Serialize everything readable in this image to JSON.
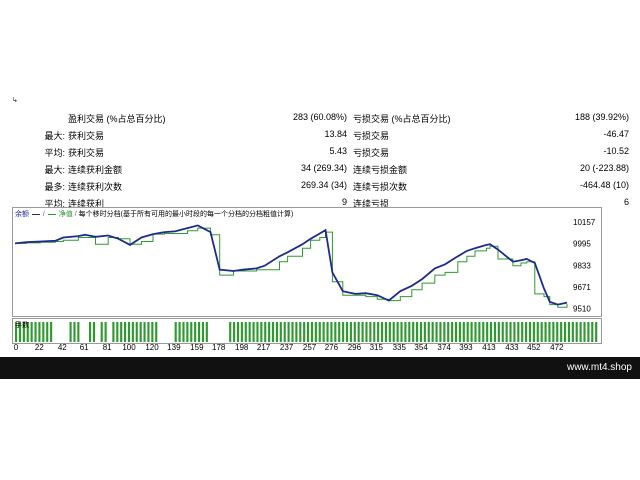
{
  "marker": "↳",
  "stats": [
    {
      "prefix": "",
      "label": "盈利交易 (%占总百分比)",
      "value1": "283 (60.08%)",
      "label2": "亏损交易 (%占总百分比)",
      "value2": "188 (39.92%)"
    },
    {
      "prefix": "最大:",
      "label": "获利交易",
      "value1": "13.84",
      "label2": "亏损交易",
      "value2": "-46.47"
    },
    {
      "prefix": "平均:",
      "label": "获利交易",
      "value1": "5.43",
      "label2": "亏损交易",
      "value2": "-10.52"
    },
    {
      "prefix": "最大:",
      "label": "连续获利金额",
      "value1": "34 (269.34)",
      "label2": "连续亏损金额",
      "value2": "20 (-223.88)"
    },
    {
      "prefix": "最多:",
      "label": "连续获利次数",
      "value1": "269.34 (34)",
      "label2": "连续亏损次数",
      "value2": "-464.48 (10)"
    },
    {
      "prefix": "平均:",
      "label": "连续获利",
      "value1": "9",
      "label2": "连续亏损",
      "value2": "6"
    }
  ],
  "chart": {
    "legend_balance": "余额",
    "legend_equity": "净值",
    "title_text": "每个移时分档(基于所有可用的最小时段的每一个分档的分档粗值计算)",
    "volume_label": "手数"
  },
  "chart_data": {
    "type": "line",
    "x_ticks": [
      "0",
      "22",
      "42",
      "61",
      "81",
      "100",
      "120",
      "139",
      "159",
      "178",
      "198",
      "217",
      "237",
      "257",
      "276",
      "296",
      "315",
      "335",
      "354",
      "374",
      "393",
      "413",
      "433",
      "452",
      "472"
    ],
    "y_ticks": [
      "10157",
      "9995",
      "9833",
      "9671",
      "9510"
    ],
    "ylim": [
      9485,
      10200
    ],
    "xlim": [
      0,
      480
    ],
    "series": [
      {
        "name": "余额",
        "color": "#1f2a8c",
        "x": [
          0,
          10,
          22,
          35,
          42,
          55,
          61,
          70,
          81,
          90,
          100,
          110,
          120,
          130,
          139,
          150,
          159,
          170,
          178,
          190,
          198,
          210,
          217,
          230,
          237,
          250,
          257,
          265,
          270,
          276,
          285,
          296,
          305,
          315,
          325,
          335,
          345,
          354,
          365,
          374,
          385,
          393,
          400,
          410,
          413,
          420,
          433,
          440,
          445,
          452,
          460,
          465,
          472,
          480
        ],
        "y": [
          9996,
          10005,
          10010,
          10015,
          10040,
          10050,
          10060,
          10045,
          10055,
          10030,
          9985,
          10040,
          10065,
          10080,
          10085,
          10110,
          10130,
          10080,
          9800,
          9790,
          9800,
          9810,
          9830,
          9900,
          9930,
          9990,
          10030,
          10070,
          10095,
          9780,
          9640,
          9620,
          9625,
          9610,
          9570,
          9640,
          9680,
          9730,
          9810,
          9840,
          9900,
          9940,
          9960,
          9985,
          9990,
          9950,
          9860,
          9870,
          9880,
          9850,
          9660,
          9560,
          9540,
          9555
        ]
      },
      {
        "name": "净值",
        "color": "#2e9a2e",
        "x": [
          0,
          10,
          22,
          35,
          42,
          55,
          61,
          70,
          81,
          90,
          100,
          110,
          120,
          130,
          139,
          150,
          159,
          170,
          178,
          190,
          198,
          210,
          217,
          230,
          237,
          250,
          257,
          265,
          270,
          276,
          285,
          296,
          305,
          315,
          325,
          335,
          345,
          354,
          365,
          374,
          385,
          393,
          400,
          410,
          413,
          420,
          433,
          440,
          445,
          452,
          460,
          465,
          472,
          480
        ],
        "y": [
          9996,
          10000,
          10005,
          10010,
          10020,
          10040,
          10040,
          9990,
          10040,
          10030,
          9990,
          10010,
          10065,
          10070,
          10070,
          10090,
          10110,
          10060,
          9760,
          9790,
          9790,
          9800,
          9800,
          9860,
          9900,
          9960,
          10020,
          10040,
          10080,
          9710,
          9610,
          9610,
          9600,
          9580,
          9570,
          9600,
          9650,
          9700,
          9760,
          9780,
          9860,
          9900,
          9940,
          9960,
          9975,
          9880,
          9830,
          9850,
          9860,
          9620,
          9600,
          9540,
          9520,
          9545
        ]
      }
    ],
    "volume": [
      1,
      1,
      1,
      1,
      1,
      1,
      1,
      1,
      1,
      1,
      0,
      0,
      0,
      0,
      1,
      1,
      1,
      0,
      0,
      1,
      1,
      0,
      1,
      1,
      0,
      1,
      1,
      1,
      1,
      1,
      1,
      1,
      1,
      1,
      1,
      1,
      1,
      0,
      0,
      0,
      0,
      1,
      1,
      1,
      1,
      1,
      1,
      1,
      1,
      1,
      0,
      0,
      0,
      0,
      0,
      1,
      1,
      1,
      1,
      1,
      1,
      1,
      1,
      1,
      1,
      1,
      1,
      1,
      1,
      1,
      1,
      1,
      1,
      1,
      1,
      1,
      1,
      1,
      1,
      1,
      1,
      1,
      1,
      1,
      1,
      1,
      1,
      1,
      1,
      1,
      1,
      1,
      1,
      1,
      1,
      1,
      1,
      1,
      1,
      1,
      1,
      1,
      1,
      1,
      1,
      1,
      1,
      1,
      1,
      1,
      1,
      1,
      1,
      1,
      1,
      1,
      1,
      1,
      1,
      1,
      1,
      1,
      1,
      1,
      1,
      1,
      1,
      1,
      1,
      1,
      1,
      1,
      1,
      1,
      1,
      1,
      1,
      1,
      1,
      1,
      1,
      1,
      1,
      1,
      1,
      1,
      1,
      1,
      1,
      1
    ]
  },
  "footer": {
    "watermark": "www.mt4.shop"
  }
}
